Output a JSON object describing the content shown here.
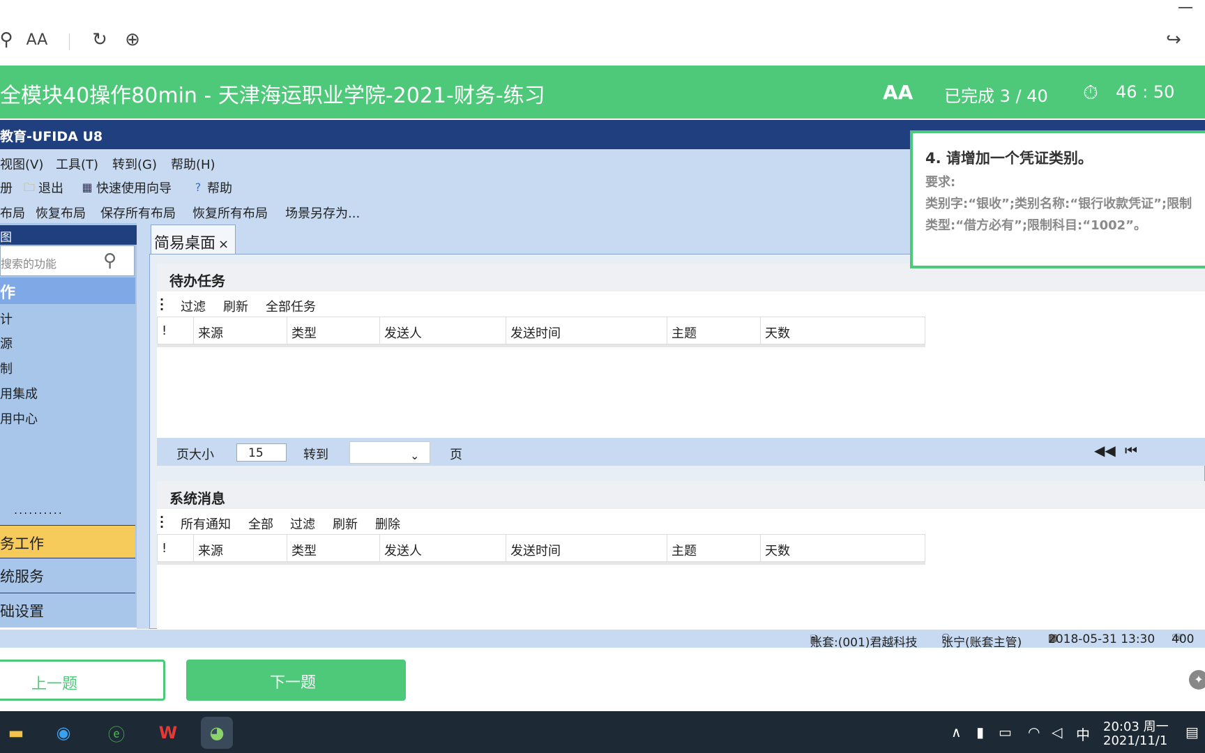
{
  "browser": {
    "icons": [
      "link-icon",
      "read-aloud-icon",
      "refresh-icon",
      "globe-icon",
      "share-icon"
    ],
    "read_aloud_label": "AA"
  },
  "exam": {
    "title": "全模块40操作80min - 天津海运职业学院-2021-财务-练习",
    "font_icon_label": "AA",
    "progress": "已完成 3 / 40",
    "timer": "46 : 50",
    "prev_label": "上一题",
    "next_label": "下一题",
    "accent_color": "#4ec97a"
  },
  "app": {
    "title": "教育-UFIDA U8",
    "menu": [
      "视图(V)",
      "工具(T)",
      "转到(G)",
      "帮助(H)"
    ],
    "toolbar": [
      "册",
      "退出",
      "快速使用向导",
      "帮助"
    ],
    "layout": [
      "布局",
      "恢复布局",
      "保存所有布局",
      "恢复所有布局",
      "场景另存为..."
    ],
    "brand_color": "#1f3f7f"
  },
  "nav": {
    "header": "图",
    "search_placeholder": "搜索的功能",
    "category": "作",
    "items": [
      "计",
      "源",
      "制",
      "用集成",
      "用中心"
    ],
    "dots": "..........",
    "modules": [
      "务工作",
      "统服务",
      "础设置"
    ]
  },
  "main": {
    "tab_label": "简易桌面",
    "tab_close": "×",
    "todo": {
      "title": "待办任务",
      "tools": [
        "过滤",
        "刷新",
        "全部任务"
      ]
    },
    "messages": {
      "title": "系统消息",
      "tools": [
        "所有通知",
        "全部",
        "过滤",
        "刷新",
        "删除"
      ]
    },
    "columns": [
      "!",
      "来源",
      "类型",
      "发送人",
      "发送时间",
      "主题",
      "天数"
    ],
    "pager": {
      "page_size_label": "页大小",
      "page_size": "15",
      "goto_label": "转到",
      "page_label": "页"
    }
  },
  "question": {
    "title": "4. 请增加一个凭证类别。",
    "req_label": "要求:",
    "body": "类别字:“银收”;类别名称:“银行收款凭证”;限制类型:“借方必有”;限制科目:“1002”。"
  },
  "status": {
    "account": "账套:(001)君越科技",
    "user": "张宁(账套主管)",
    "datetime": "2018-05-31 13:30",
    "phone": "400"
  },
  "taskbar": {
    "ime": "中",
    "time": "20:03 周一",
    "date": "2021/11/1"
  }
}
